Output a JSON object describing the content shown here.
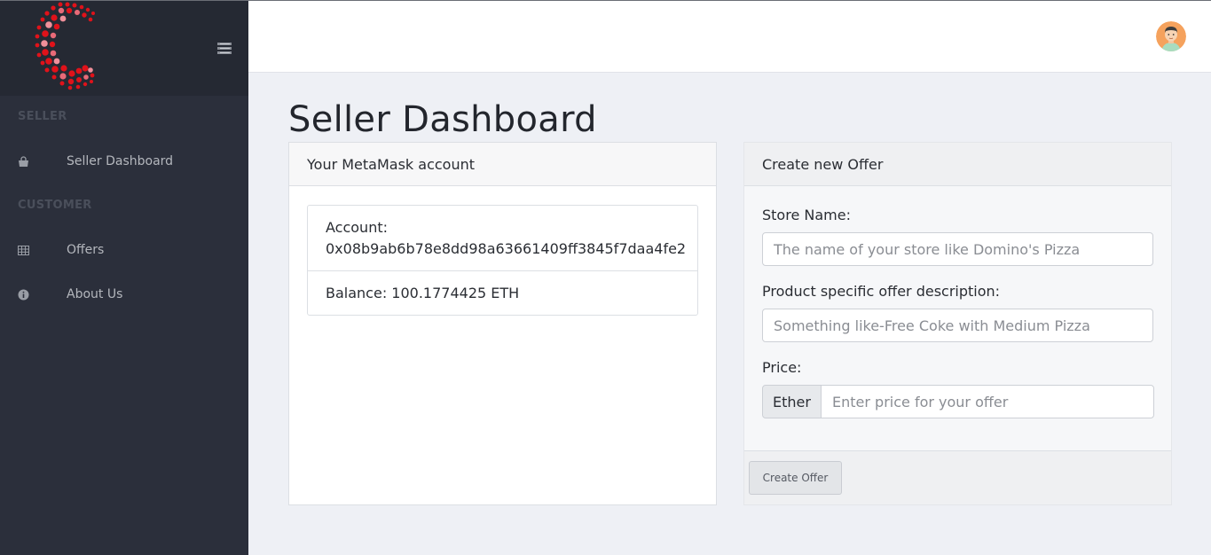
{
  "sidebar": {
    "sections": [
      {
        "title": "SELLER"
      },
      {
        "title": "CUSTOMER"
      }
    ],
    "items": [
      {
        "label": "Seller Dashboard",
        "icon": "shopping-bag-icon"
      },
      {
        "label": "Offers",
        "icon": "table-icon"
      },
      {
        "label": "About Us",
        "icon": "info-circle-icon"
      }
    ],
    "toggle_icon": "hamburger-menu-icon"
  },
  "header": {
    "avatar_icon": "user-avatar-icon"
  },
  "page": {
    "title": "Seller Dashboard"
  },
  "account_card": {
    "header": "Your MetaMask account",
    "account_label": "Account:",
    "account_address": "0x08b9ab6b78e8dd98a63661409ff3845f7daa4fe2",
    "balance": "Balance: 100.1774425 ETH"
  },
  "offer_form": {
    "header": "Create new Offer",
    "store_name_label": "Store Name:",
    "store_name_placeholder": "The name of your store like Domino's Pizza",
    "description_label": "Product specific offer description:",
    "description_placeholder": "Something like-Free Coke with Medium Pizza",
    "price_label": "Price:",
    "price_addon": "Ether",
    "price_placeholder": "Enter price for your offer",
    "submit_label": "Create Offer"
  },
  "colors": {
    "sidebar_bg": "#2b2f3b",
    "sidebar_head_bg": "#252933",
    "logo_red": "#e0121a",
    "page_bg": "#eef0f5"
  }
}
